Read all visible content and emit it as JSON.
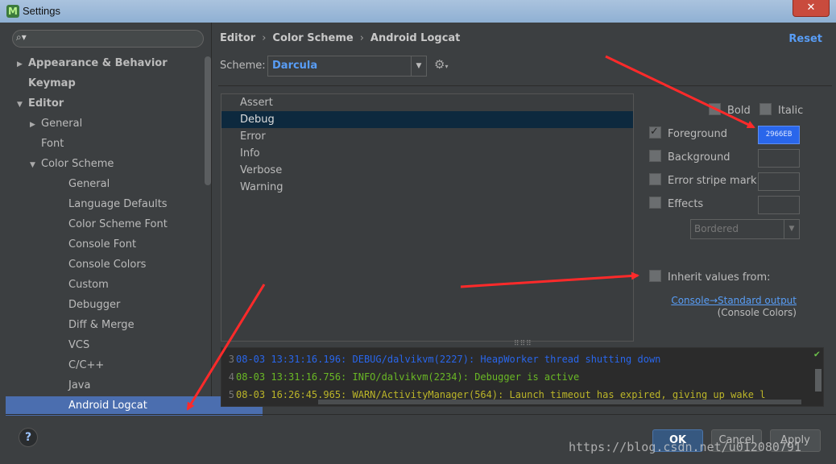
{
  "window": {
    "title": "Settings",
    "close_glyph": "✕"
  },
  "sidebar": {
    "search_placeholder": "",
    "items": [
      {
        "label": "Appearance & Behavior",
        "bold": true,
        "arrow": "▶",
        "level": 0
      },
      {
        "label": "Keymap",
        "bold": true,
        "arrow": "",
        "level": 0
      },
      {
        "label": "Editor",
        "bold": true,
        "arrow": "▼",
        "level": 0
      },
      {
        "label": "General",
        "arrow": "▶",
        "level": 1
      },
      {
        "label": "Font",
        "arrow": "",
        "level": 1
      },
      {
        "label": "Color Scheme",
        "arrow": "▼",
        "level": 1
      },
      {
        "label": "General",
        "level": 2
      },
      {
        "label": "Language Defaults",
        "level": 2
      },
      {
        "label": "Color Scheme Font",
        "level": 2
      },
      {
        "label": "Console Font",
        "level": 2
      },
      {
        "label": "Console Colors",
        "level": 2
      },
      {
        "label": "Custom",
        "level": 2
      },
      {
        "label": "Debugger",
        "level": 2
      },
      {
        "label": "Diff & Merge",
        "level": 2
      },
      {
        "label": "VCS",
        "level": 2
      },
      {
        "label": "C/C++",
        "level": 2
      },
      {
        "label": "Java",
        "level": 2
      },
      {
        "label": "Android Logcat",
        "level": 2,
        "selected": true
      }
    ]
  },
  "header": {
    "breadcrumb": [
      "Editor",
      "Color Scheme",
      "Android Logcat"
    ],
    "reset_label": "Reset"
  },
  "scheme": {
    "label": "Scheme:",
    "value": "Darcula"
  },
  "log_levels": [
    "Assert",
    "Debug",
    "Error",
    "Info",
    "Verbose",
    "Warning"
  ],
  "options": {
    "bold_label": "Bold",
    "italic_label": "Italic",
    "foreground_label": "Foreground",
    "foreground_color": "2966EB",
    "background_label": "Background",
    "error_stripe_label": "Error stripe mark",
    "effects_label": "Effects",
    "effects_value": "Bordered",
    "inherit_label": "Inherit values from:",
    "inherit_link": "Console→Standard output",
    "inherit_sub": "(Console Colors)"
  },
  "preview": {
    "lines": [
      {
        "num": "3",
        "text": "08-03 13:31:16.196: DEBUG/dalvikvm(2227): HeapWorker thread shutting down",
        "color": "#2966eb"
      },
      {
        "num": "4",
        "text": "08-03 13:31:16.756: INFO/dalvikvm(2234): Debugger is active",
        "color": "#6ab825"
      },
      {
        "num": "5",
        "text": "08-03 16:26:45.965: WARN/ActivityManager(564): Launch timeout has expired, giving up wake l",
        "color": "#bbb529"
      }
    ]
  },
  "buttons": {
    "ok": "OK",
    "cancel": "Cancel",
    "apply": "Apply",
    "help": "?"
  },
  "watermark": "https://blog.csdn.net/u012080791",
  "colors": {
    "accent": "#589df6",
    "selection": "#4b6eaf",
    "annotation_arrow": "#ff2a2a"
  }
}
